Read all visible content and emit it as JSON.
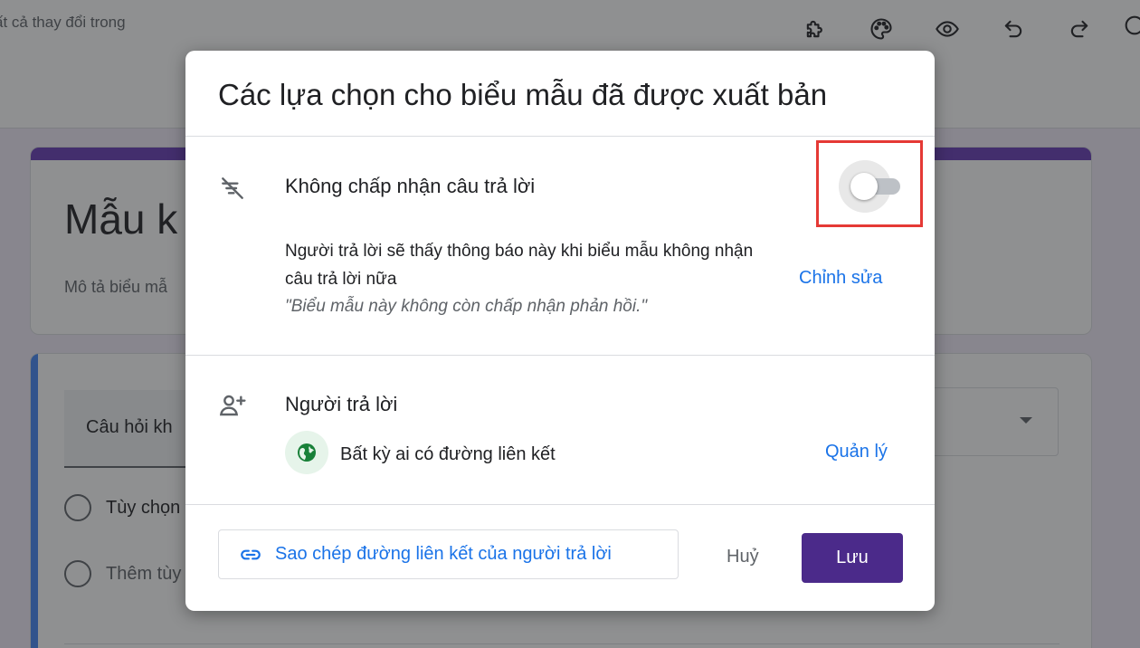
{
  "topbar": {
    "saved_status": "ất cả thay đổi trong",
    "icons": [
      "puzzle-icon",
      "palette-icon",
      "eye-icon",
      "undo-icon",
      "redo-icon",
      "more-icon"
    ]
  },
  "form": {
    "title": "Mẫu k",
    "description": "Mô tả biểu mẫ",
    "accent_color": "#673ab7"
  },
  "question": {
    "text": "Câu hỏi kh",
    "options": [
      "Tùy chọn",
      "Thêm tùy"
    ]
  },
  "dialog": {
    "title": "Các lựa chọn cho biểu mẫu đã được xuất bản",
    "accepting": {
      "label": "Không chấp nhận câu trả lời",
      "toggle_on": false,
      "message": "Người trả lời sẽ thấy thông báo này khi biểu mẫu không nhận câu trả lời nữa",
      "quote": "\"Biểu mẫu này không còn chấp nhận phản hồi.\"",
      "edit_label": "Chỉnh sửa"
    },
    "responders": {
      "label": "Người trả lời",
      "access": "Bất kỳ ai có đường liên kết",
      "manage_label": "Quản lý"
    },
    "footer": {
      "copy_link_label": "Sao chép đường liên kết của người trả lời",
      "cancel_label": "Huỷ",
      "save_label": "Lưu"
    }
  },
  "colors": {
    "primary": "#4b2a8a",
    "link": "#1a73e8",
    "highlight": "#e53935",
    "globe": "#188038"
  }
}
